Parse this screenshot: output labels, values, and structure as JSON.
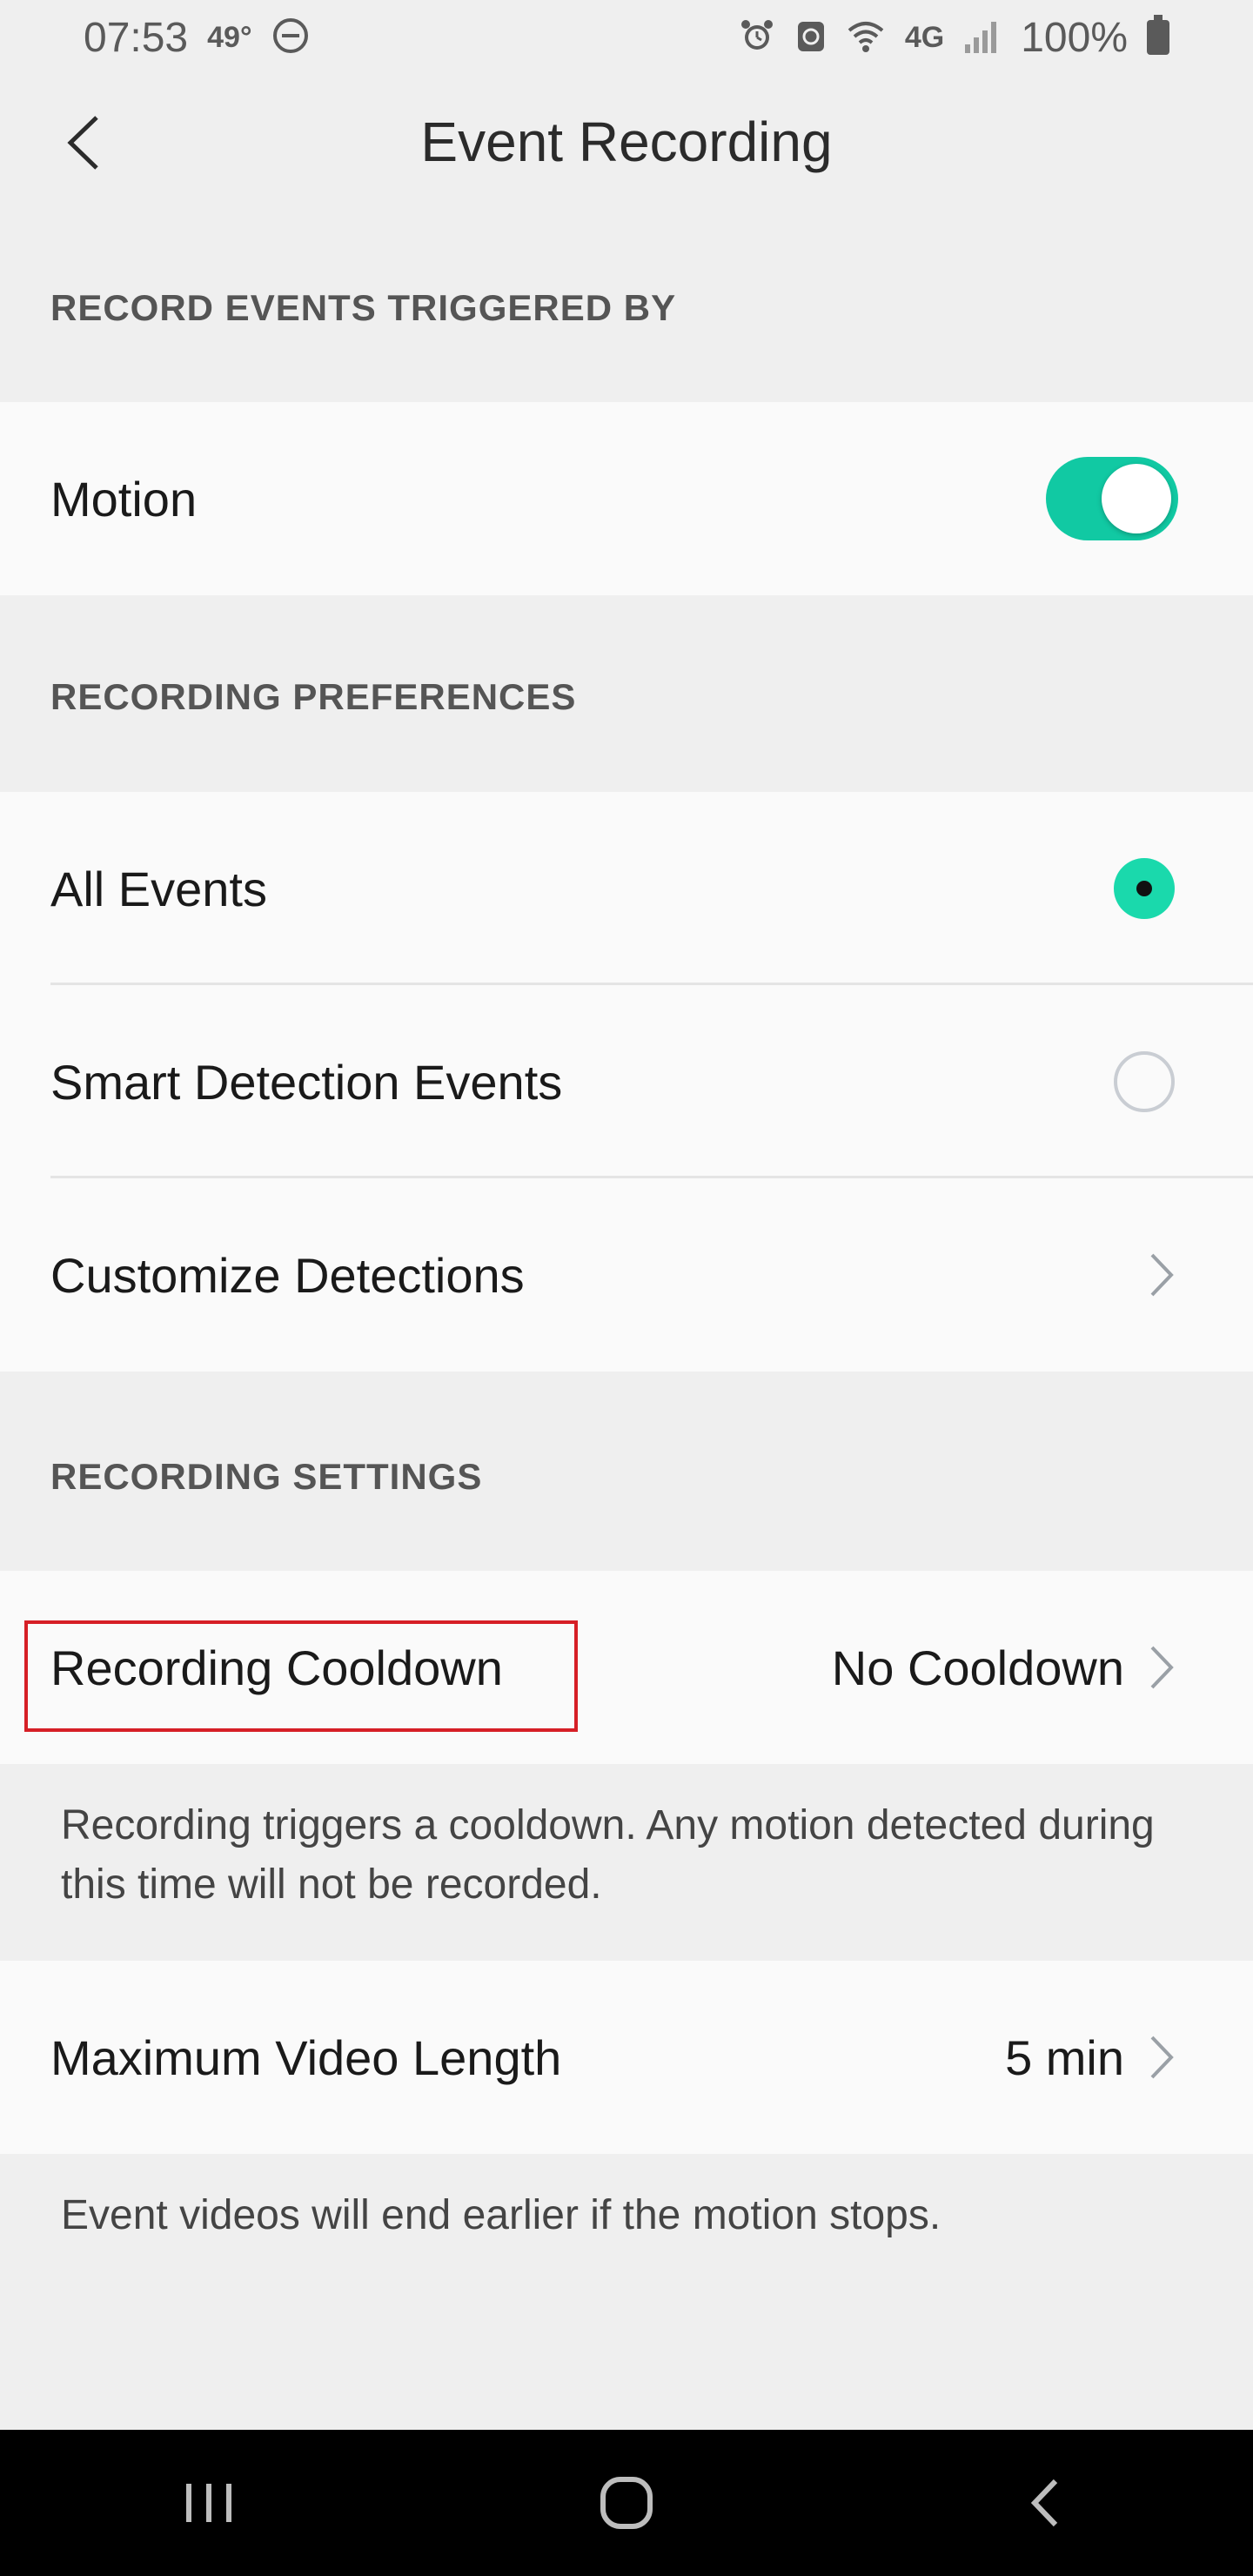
{
  "status_bar": {
    "time": "07:53",
    "temp": "49°",
    "signal": "4G",
    "battery": "100%"
  },
  "header": {
    "title": "Event Recording",
    "back_icon": "chevron-left-icon"
  },
  "sections": {
    "triggers": {
      "heading": "RECORD EVENTS TRIGGERED BY",
      "motion_label": "Motion",
      "motion_enabled": true
    },
    "preferences": {
      "heading": "RECORDING PREFERENCES",
      "options": [
        {
          "label": "All Events",
          "selected": true
        },
        {
          "label": "Smart Detection Events",
          "selected": false
        }
      ],
      "customize_label": "Customize Detections"
    },
    "settings": {
      "heading": "RECORDING SETTINGS",
      "cooldown_label": "Recording Cooldown",
      "cooldown_value": "No Cooldown",
      "cooldown_help": "Recording triggers a cooldown. Any motion detected during this time will not be recorded.",
      "max_length_label": "Maximum Video Length",
      "max_length_value": "5 min",
      "max_length_help": "Event videos will end earlier if the motion stops."
    }
  },
  "colors": {
    "accent": "#11c9a3",
    "highlight": "#d61f26"
  },
  "nav_bar": {
    "icons": [
      "recent-apps-icon",
      "home-icon",
      "back-icon"
    ]
  }
}
